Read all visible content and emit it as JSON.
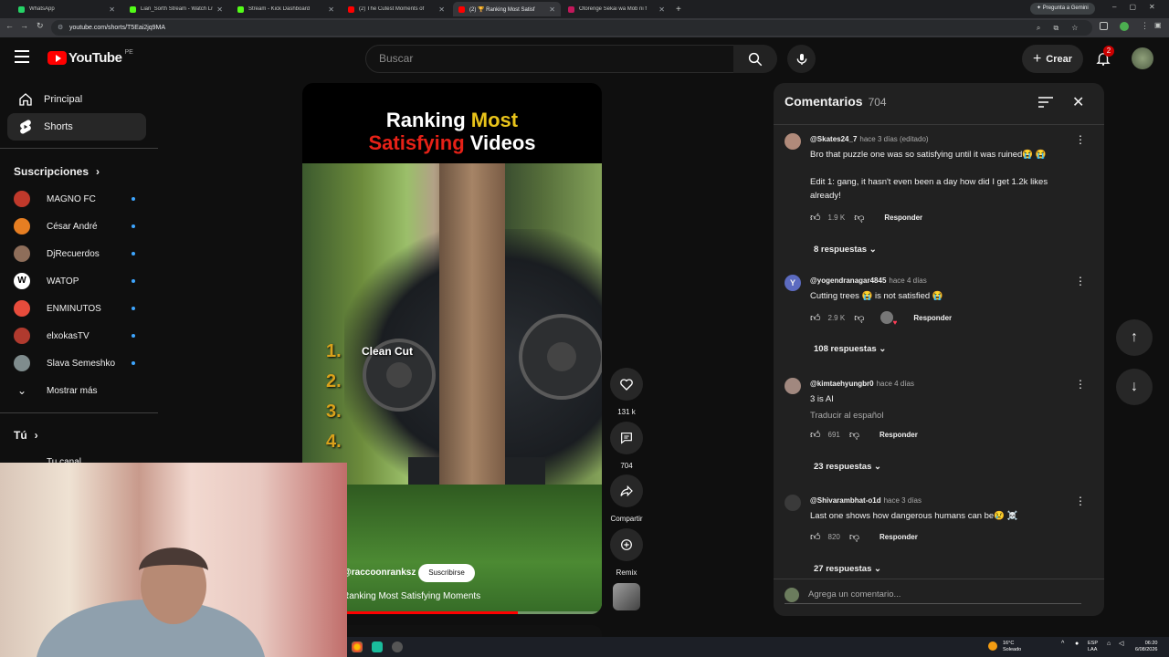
{
  "browser": {
    "tabs": [
      {
        "label": "WhatsApp",
        "color": "#25d366"
      },
      {
        "label": "Lian_Sorth Stream - Watch Liv",
        "color": "#53fc18"
      },
      {
        "label": "Stream - Kick Dashboard",
        "color": "#53fc18"
      },
      {
        "label": "(2) The Cutest Moments of",
        "color": "#ff0000"
      },
      {
        "label": "(2) 🏆 Ranking Most Satisf",
        "color": "#ff0000"
      },
      {
        "label": "Otorenge Sekai wa Mob ni f",
        "color": "#c2185b"
      }
    ],
    "url": "youtube.com/shorts/T5Eai2jq9MA",
    "gemini": "Pregunta a Gemini"
  },
  "youtube": {
    "logo_text": "YouTube",
    "region": "PE",
    "search_placeholder": "Buscar",
    "create_label": "Crear",
    "notifications": "2"
  },
  "sidebar": {
    "main": [
      {
        "label": "Principal",
        "icon": "home-icon"
      },
      {
        "label": "Shorts",
        "icon": "shorts-icon"
      }
    ],
    "subs_header": "Suscripciones",
    "subscriptions": [
      {
        "label": "MAGNO FC",
        "color": "#c0392b"
      },
      {
        "label": "César André",
        "color": "#e67e22"
      },
      {
        "label": "DjRecuerdos",
        "color": "#8e6e5a"
      },
      {
        "label": "WATOP",
        "color": "#ffffff"
      },
      {
        "label": "ENMINUTOS",
        "color": "#e74c3c"
      },
      {
        "label": "elxokasTV",
        "color": "#b03a2e"
      },
      {
        "label": "Slava Semeshko",
        "color": "#7f8c8d"
      }
    ],
    "show_more": "Mostrar más",
    "you_header": "Tú",
    "your_channel": "Tu canal"
  },
  "short": {
    "title_line1_a": "Ranking ",
    "title_line1_b": "Most",
    "title_line2_a": "Satisfying",
    "title_line2_b": " Videos",
    "ranks": [
      "1.",
      "2.",
      "3.",
      "4."
    ],
    "rank1_label": "Clean Cut",
    "channel": "@raccoonranksz",
    "subscribe": "Suscribirse",
    "caption": "Ranking Most Satisfying Moments",
    "progress_fraction": 0.72,
    "likes": "131 k",
    "comments": "704",
    "share": "Compartir",
    "remix": "Remix"
  },
  "comments": {
    "title": "Comentarios",
    "count": "704",
    "items": [
      {
        "user": "@Skates24_7",
        "time": "hace 3 días (editado)",
        "lines": [
          "Bro that puzzle one was so satisfying until it was ruined😭 😭",
          "",
          "Edit 1: gang, it hasn't even been a day how did I get 1.2k likes",
          "already!"
        ],
        "likes": "1.9 K",
        "reply": "Responder",
        "replies": "8 respuestas",
        "avatar": "#b08a7a"
      },
      {
        "user": "@yogendranagar4845",
        "time": "hace 4 días",
        "lines": [
          "Cutting trees 😭 is not satisfied 😭"
        ],
        "likes": "2.9 K",
        "reply": "Responder",
        "replies": "108 respuestas",
        "avatar": "#5c6bc0",
        "initial": "Y"
      },
      {
        "user": "@kimtaehyungbr0",
        "time": "hace 4 días",
        "lines": [
          "3 is AI"
        ],
        "translate": "Traducir al español",
        "likes": "691",
        "reply": "Responder",
        "replies": "23 respuestas",
        "avatar": "#a1887f"
      },
      {
        "user": "@Shivarambhat-o1d",
        "time": "hace 3 días",
        "lines": [
          "Last one shows how dangerous humans can be😢 ☠️"
        ],
        "likes": "820",
        "reply": "Responder",
        "replies": "27 respuestas",
        "avatar": "#3a3a3a"
      }
    ],
    "add_placeholder": "Agrega un comentario..."
  },
  "taskbar": {
    "weather_temp": "16°C",
    "weather_desc": "Soleado",
    "lang1": "ESP",
    "lang2": "LAA",
    "time": "06:20",
    "date": "6/08/2026"
  },
  "colors": {
    "youtube_red": "#ff0000",
    "accent_blue": "#3ea6ff",
    "gold": "#e8c31a",
    "title_red": "#e62117"
  }
}
